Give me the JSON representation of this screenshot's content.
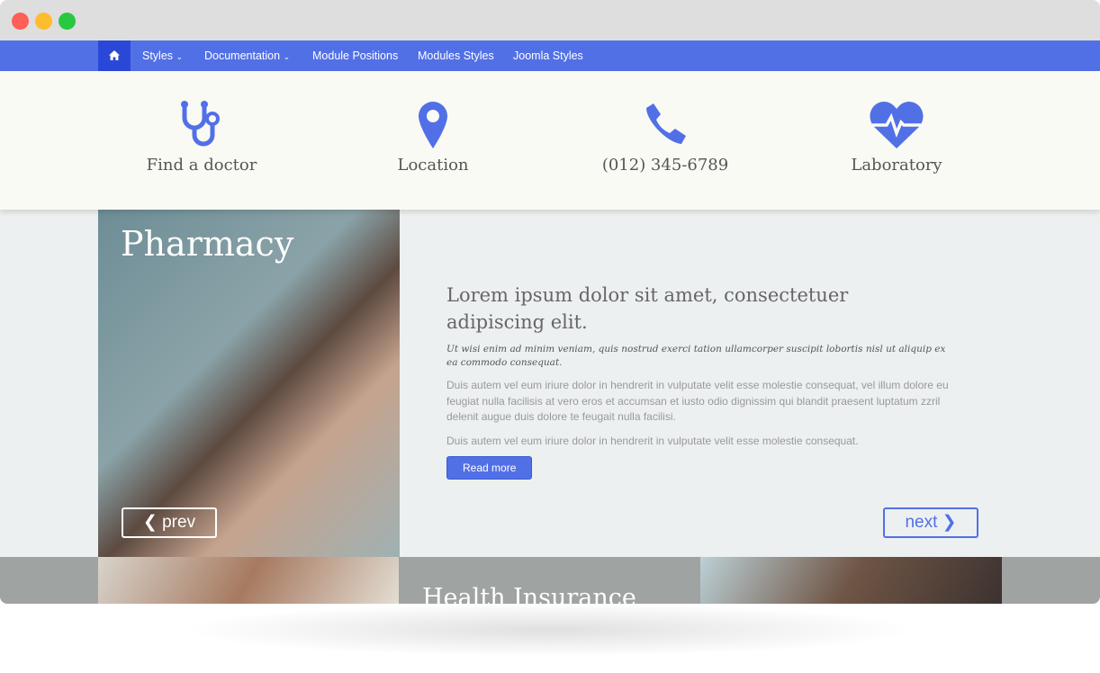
{
  "nav": {
    "items": [
      {
        "label": "Styles"
      },
      {
        "label": "Documentation"
      },
      {
        "label": "Module Positions"
      },
      {
        "label": "Modules Styles"
      },
      {
        "label": "Joomla Styles"
      }
    ],
    "home_icon": "home-icon",
    "accent": "#5270e6"
  },
  "features": [
    {
      "label": "Find a doctor",
      "icon": "stethoscope-icon"
    },
    {
      "label": "Location",
      "icon": "map-marker-icon"
    },
    {
      "label": "(012) 345-6789",
      "icon": "phone-icon"
    },
    {
      "label": "Laboratory",
      "icon": "heartbeat-icon"
    }
  ],
  "slide": {
    "image_title": "Pharmacy",
    "heading": "Lorem ipsum dolor sit amet, consectetuer adipiscing elit.",
    "lead": "Ut wisi enim ad minim veniam, quis nostrud exerci tation ullamcorper suscipit lobortis nisl ut aliquip ex ea commodo consequat.",
    "para1": "Duis autem vel eum iriure dolor in hendrerit in vulputate velit esse molestie consequat, vel illum dolore eu feugiat nulla facilisis at vero eros et accumsan et iusto odio dignissim qui blandit praesent luptatum zzril delenit augue duis dolore te feugait nulla facilisi.",
    "para2": "Duis autem vel eum iriure dolor in hendrerit in vulputate velit esse molestie consequat.",
    "read_more": "Read more",
    "prev": "prev",
    "next": "next"
  },
  "bottom": {
    "title": "Health Insurance"
  }
}
